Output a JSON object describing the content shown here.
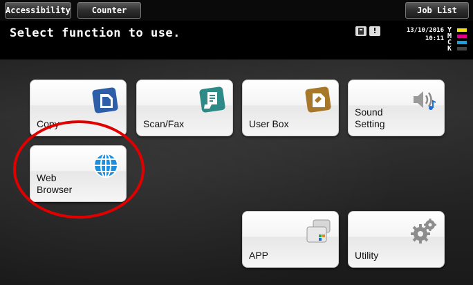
{
  "topbar": {
    "accessibility_label": "Accessibility",
    "counter_label": "Counter",
    "job_list_label": "Job List"
  },
  "header": {
    "title": "Select function to use.",
    "date": "13/10/2016",
    "time": "10:11",
    "toner": [
      {
        "letter": "Y",
        "color": "#f5e000"
      },
      {
        "letter": "M",
        "color": "#e0008a"
      },
      {
        "letter": "C",
        "color": "#1ea0dc"
      },
      {
        "letter": "K",
        "color": "#444444"
      }
    ]
  },
  "tiles": {
    "copy": {
      "label": "Copy",
      "icon": "copy-icon"
    },
    "scan_fax": {
      "label": "Scan/Fax",
      "icon": "scan-fax-icon"
    },
    "user_box": {
      "label": "User Box",
      "icon": "user-box-icon"
    },
    "sound_setting": {
      "label": "Sound\nSetting",
      "icon": "speaker-icon"
    },
    "web_browser": {
      "label": "Web\nBrowser",
      "icon": "globe-icon"
    },
    "app": {
      "label": "APP",
      "icon": "app-icon"
    },
    "utility": {
      "label": "Utility",
      "icon": "gears-icon"
    }
  },
  "colors": {
    "highlight": "#e00000",
    "copy_icon": "#2f5ea8",
    "scan_icon": "#2e8a86",
    "userbox_icon": "#a8782a",
    "globe_icon": "#1d8fe0"
  }
}
